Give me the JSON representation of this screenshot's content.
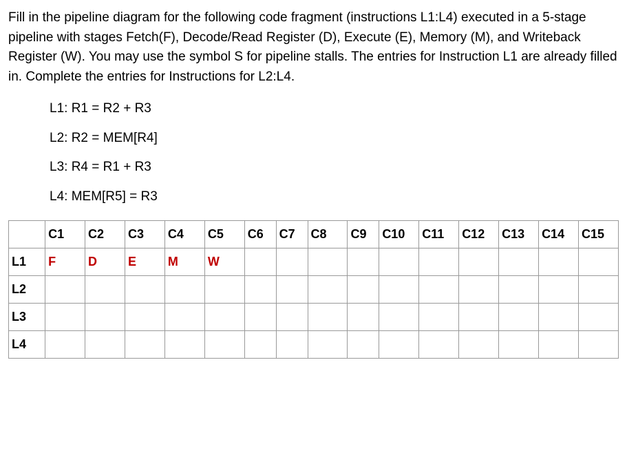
{
  "intro": "Fill in the pipeline diagram for the following code fragment (instructions L1:L4) executed in a 5-stage pipeline with stages Fetch(F), Decode/Read Register (D), Execute (E), Memory (M), and Writeback Register (W). You may use the symbol S for pipeline stalls. The entries for Instruction L1 are already filled in. Complete the entries for Instructions for L2:L4.",
  "code": {
    "l1": "L1: R1 = R2 + R3",
    "l2": "L2: R2 = MEM[R4]",
    "l3": "L3: R4 = R1 + R3",
    "l4": "L4: MEM[R5] = R3"
  },
  "table": {
    "headers": [
      "C1",
      "C2",
      "C3",
      "C4",
      "C5",
      "C6",
      "C7",
      "C8",
      "C9",
      "C10",
      "C11",
      "C12",
      "C13",
      "C14",
      "C15"
    ],
    "rows": [
      {
        "label": "L1",
        "cells": [
          "F",
          "D",
          "E",
          "M",
          "W",
          "",
          "",
          "",
          "",
          "",
          "",
          "",
          "",
          "",
          ""
        ]
      },
      {
        "label": "L2",
        "cells": [
          "",
          "",
          "",
          "",
          "",
          "",
          "",
          "",
          "",
          "",
          "",
          "",
          "",
          "",
          ""
        ]
      },
      {
        "label": "L3",
        "cells": [
          "",
          "",
          "",
          "",
          "",
          "",
          "",
          "",
          "",
          "",
          "",
          "",
          "",
          "",
          ""
        ]
      },
      {
        "label": "L4",
        "cells": [
          "",
          "",
          "",
          "",
          "",
          "",
          "",
          "",
          "",
          "",
          "",
          "",
          "",
          "",
          ""
        ]
      }
    ]
  }
}
